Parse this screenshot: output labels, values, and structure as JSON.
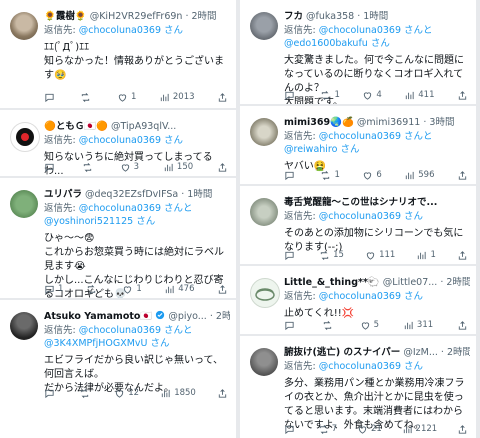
{
  "icons": {
    "reply": "reply-icon",
    "retweet": "retweet-icon",
    "like": "heart-icon",
    "views": "views-icon",
    "share": "share-icon",
    "verified": "verified-badge-icon",
    "more": "more-icon"
  },
  "colors": {
    "link": "#1d9bf0",
    "muted": "#536471",
    "verified": "#1d9bf0",
    "divider": "#e7e9ec"
  },
  "left_tweets": [
    {
      "name": "🌻霞樹🌻",
      "handle": "@KiH2VR29efFr69n · 2時間",
      "reply_prefix": "返信先: ",
      "reply_mentions": "@chocoluna0369 さん",
      "text": "ｴｴ(ﾟДﾟ)ｴｴ\n知らなかった！情報ありがとうございます🥹",
      "reply_count": "",
      "retweet_count": "",
      "like_count": "1",
      "views": "2013"
    },
    {
      "name": "🟠ともＧ🇯🇵🟠",
      "handle": "@TipA93qlV...",
      "reply_prefix": "返信先: ",
      "reply_mentions": "@chocoluna0369 さん",
      "text": "知らないうちに絶対買ってしまってるわ...",
      "reply_count": "",
      "retweet_count": "",
      "like_count": "3",
      "views": "150"
    },
    {
      "name": "ユリパラ",
      "handle": "@deq32EZsfDvIFSa · 1時間",
      "reply_prefix": "返信先: ",
      "reply_mentions": "@chocoluna0369 さんと @yoshinori521125 さん",
      "text": "ひゃ〜〜😨\nこれからお惣菜買う時には絶対にラベル見ます😭\nしかし...こんなにじわりじわりと忍び寄るコオロギども💀",
      "reply_count": "1",
      "retweet_count": "",
      "like_count": "1",
      "views": "476"
    },
    {
      "name": "Atsuko Yamamoto🇯🇵",
      "handle": "@piyo...",
      "time": "· 2時間",
      "reply_prefix": "返信先: ",
      "reply_mentions": "@chocoluna0369 さんと @3K4XMPfjHOGXMvU さん",
      "text": "エビフライだから良い訳じゃ無いって、何回言えば。\nだから法律が必要なんだよ。",
      "reply_count": "",
      "retweet_count": "",
      "like_count": "12",
      "views": "1850"
    }
  ],
  "right_tweets": [
    {
      "name": "フカ",
      "handle": "@fuka358 · 1時間",
      "reply_prefix": "返信先: ",
      "reply_mentions": "@chocoluna0369 さんと @edo1600bakufu さん",
      "text": "大変驚きました。何で今こんなに問題になっているのに断りなくコオロギ入れてんのよ？\n大問題です。",
      "reply_count": "",
      "retweet_count": "1",
      "like_count": "4",
      "views": "411"
    },
    {
      "name": "mimi369🌏🍊",
      "handle": "@mimi36911 · 3時間",
      "reply_prefix": "返信先: ",
      "reply_mentions": "@chocoluna0369 さんと @reiwahiro さん",
      "text": "ヤバい🤮",
      "reply_count": "",
      "retweet_count": "1",
      "like_count": "6",
      "views": "596"
    },
    {
      "name": "毒舌覚醒龍〜この世はシナリオで...",
      "handle": "",
      "reply_prefix": "返信先: ",
      "reply_mentions": "@chocoluna0369 さん",
      "text": "そのあとの添加物にシリコーンでも気になります(--;)",
      "reply_count": "",
      "retweet_count": "15",
      "like_count": "111",
      "views": "1"
    },
    {
      "name": "Little_&_thing**🐑",
      "handle": "@Little07... · 2時間",
      "reply_prefix": "返信先: ",
      "reply_mentions": "@chocoluna0369 さん",
      "text": "止めてくれ!!💢",
      "reply_count": "",
      "retweet_count": "",
      "like_count": "5",
      "views": "311"
    },
    {
      "name": "腑抜け(逃亡) のスナイパー",
      "handle": "@IzM... · 2時間",
      "reply_prefix": "返信先: ",
      "reply_mentions": "@chocoluna0369 さん",
      "text": "多分、業務用パン種とか業務用冷凍フライの衣とか、魚介出汁とかに昆虫を使ってると思います。末端消費者にはわからないですよ、外食も含めてね。",
      "reply_count": "",
      "retweet_count": "7",
      "like_count": "21",
      "views": "2121"
    }
  ]
}
